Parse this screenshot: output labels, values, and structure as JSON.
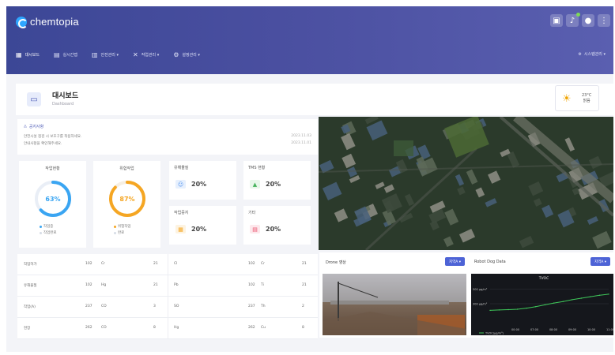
{
  "app": {
    "logo_text": "chemtopia"
  },
  "header": {
    "icons": [
      "monitor-icon",
      "bell-icon",
      "user-icon",
      "more-icon"
    ],
    "nav": [
      {
        "label": "대시보드",
        "icon": "grid-icon",
        "active": true
      },
      {
        "label": "실시간맵",
        "icon": "map-icon",
        "active": false
      },
      {
        "label": "안전관리 ▾",
        "icon": "chart-icon",
        "active": false
      },
      {
        "label": "작업관리 ▾",
        "icon": "tools-icon",
        "active": false
      },
      {
        "label": "설정관리 ▾",
        "icon": "gear-icon",
        "active": false
      }
    ],
    "system_menu": "시스템관리 ▾"
  },
  "page": {
    "title": "대시보드",
    "subtitle": "Dashboard",
    "weather": {
      "temp": "23°C",
      "desc": "맑음"
    }
  },
  "notice": {
    "label": "공지사항",
    "lines": [
      "안전시설 점검 시 보호구를 착용하세요.",
      "안내사항을 확인해주세요."
    ],
    "dates": [
      "2023.11.03",
      "2023.11.01"
    ]
  },
  "gauges": [
    {
      "title": "작업현황",
      "value_text": "63%",
      "value": 63,
      "color": "#3aa5f2",
      "legend": [
        "작업중",
        "작업완료"
      ]
    },
    {
      "title": "위험작업",
      "value_text": "87%",
      "value": 87,
      "color": "#f5a623",
      "legend": [
        "위험작업",
        "완료"
      ]
    }
  ],
  "stats": [
    {
      "title": "유해물질",
      "value": "20%",
      "icon": "people-icon",
      "color": "#e7f0fd",
      "icon_color": "#5b9af0"
    },
    {
      "title": "TMS 현황",
      "value": "20%",
      "icon": "chart-icon",
      "color": "#e7f7ea",
      "icon_color": "#45b35b"
    },
    {
      "title": "작업중지",
      "value": "20%",
      "icon": "calendar-icon",
      "color": "#fdf3e1",
      "icon_color": "#f5a623"
    },
    {
      "title": "기타",
      "value": "20%",
      "icon": "alert-icon",
      "color": "#fde8ec",
      "icon_color": "#e94f6b"
    }
  ],
  "table": {
    "rows": [
      {
        "name": "작업허가",
        "a": "102",
        "b": "Cr",
        "c": "21",
        "d": "Cl",
        "e": "102",
        "f": "Cr",
        "g": "21"
      },
      {
        "name": "유해물질",
        "a": "102",
        "b": "Hg",
        "c": "21",
        "d": "Pb",
        "e": "102",
        "f": "Ti",
        "g": "21"
      },
      {
        "name": "작업(A)",
        "a": "237",
        "b": "CO",
        "c": "3",
        "d": "SO",
        "e": "237",
        "f": "Th",
        "g": "2"
      },
      {
        "name": "현장",
        "a": "262",
        "b": "CO",
        "c": "8",
        "d": "Hg",
        "e": "262",
        "f": "Cu",
        "g": "8"
      }
    ]
  },
  "panels": {
    "cctv": {
      "title": "Drone 영상",
      "button": "지역A ▾"
    },
    "robot": {
      "title": "Robot Dog Data",
      "button": "지역A ▾"
    }
  },
  "chart_data": {
    "type": "line",
    "title": "TVOC",
    "x": [
      "00:00",
      "07:00",
      "08:00",
      "09:00",
      "10:00",
      "11:00"
    ],
    "ytick_labels": [
      "500 μg/m³",
      "300 μg/m³"
    ],
    "series": [
      {
        "name": "TVOC(μg/m³)",
        "values": [
          210,
          215,
          220,
          225,
          240,
          260,
          285,
          310,
          330,
          355,
          375,
          395,
          415,
          430
        ]
      }
    ],
    "ylim": [
      0,
      600
    ]
  }
}
